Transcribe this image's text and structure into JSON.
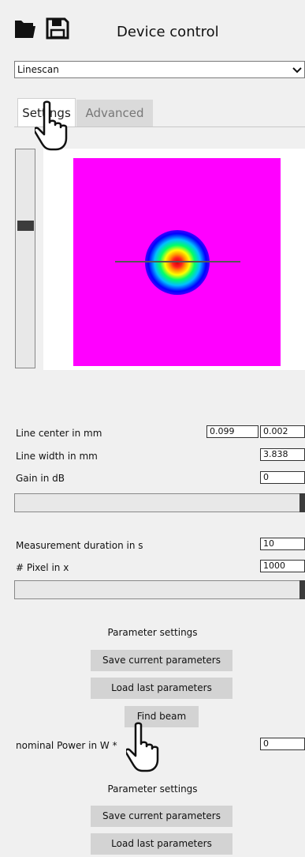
{
  "header": {
    "title": "Device control",
    "icons": [
      "folder-open-icon",
      "save-icon"
    ]
  },
  "mode_select": {
    "value": "Linescan"
  },
  "tabs": [
    {
      "label": "Settings",
      "active": true
    },
    {
      "label": "Advanced",
      "active": false
    }
  ],
  "form": {
    "line_center_label": "Line center in mm",
    "line_center_x": "0.099",
    "line_center_y": "0.002",
    "line_width_label": "Line width in mm",
    "line_width": "3.838",
    "gain_label": "Gain in dB",
    "gain": "0",
    "duration_label": "Measurement duration in s",
    "duration": "10",
    "pixel_label": "# Pixel in x",
    "pixel": "1000",
    "power_label": "nominal Power in W *",
    "power": "0"
  },
  "params1": {
    "title": "Parameter settings",
    "save": "Save current parameters",
    "load": "Load last parameters"
  },
  "find_beam": "Find beam",
  "params2": {
    "title": "Parameter settings",
    "save": "Save current parameters",
    "load": "Load last parameters"
  }
}
